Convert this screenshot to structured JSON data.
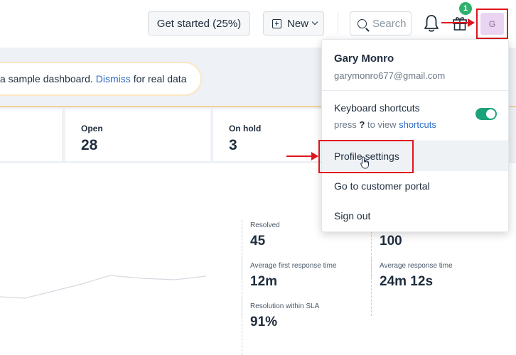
{
  "header": {
    "get_started_label": "Get started (25%)",
    "new_label": "New",
    "search_placeholder": "Search",
    "gift_badge": "1",
    "avatar_initial": "G"
  },
  "banner": {
    "text_before": "a sample dashboard.",
    "dismiss_link": "Dismiss",
    "text_after": "for real data"
  },
  "stats": [
    {
      "label": "Open",
      "value": "28"
    },
    {
      "label": "On hold",
      "value": "3"
    }
  ],
  "metrics": [
    {
      "label": "Resolved",
      "value": "45"
    },
    {
      "label": "",
      "value": "100"
    },
    {
      "label": "Average first response time",
      "value": "12m"
    },
    {
      "label": "Average response time",
      "value": "24m 12s"
    },
    {
      "label": "Resolution within SLA",
      "value": "91%"
    }
  ],
  "dropdown": {
    "user_name": "Gary Monro",
    "user_email": "garymonro677@gmail.com",
    "keyboard_shortcuts_label": "Keyboard shortcuts",
    "kb_hint_prefix": "press",
    "kb_hint_key": "?",
    "kb_hint_middle": "to view",
    "kb_hint_link": "shortcuts",
    "keyboard_shortcuts_enabled": true,
    "items": [
      {
        "label": "Profile settings"
      },
      {
        "label": "Go to customer portal"
      },
      {
        "label": "Sign out"
      }
    ]
  },
  "colors": {
    "accent_link": "#2d6cc7",
    "toggle_on": "#1aa37a",
    "badge_green": "#2fb16c",
    "annotation_red": "#e0141e"
  }
}
